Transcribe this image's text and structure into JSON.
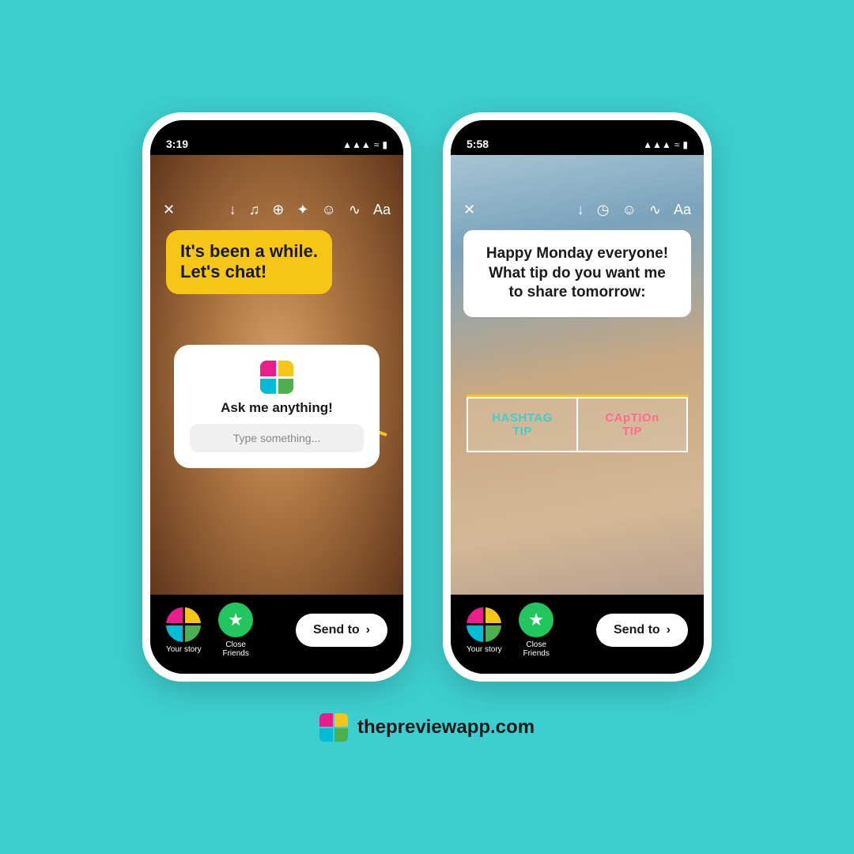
{
  "background_color": "#3DCFCF",
  "branding": {
    "website": "thepreviewapp.com"
  },
  "phone1": {
    "time": "3:19",
    "story_text_line1": "It's been a while.",
    "story_text_line2": "Let's chat!",
    "qa_title": "Ask me anything!",
    "qa_placeholder": "Type something...",
    "bottom": {
      "your_story_label": "Your story",
      "close_friends_label": "Close Friends",
      "send_to_label": "Send to"
    }
  },
  "phone2": {
    "time": "5:58",
    "caption_line1": "Happy Monday everyone!",
    "caption_line2": "What tip do you want me",
    "caption_line3": "to share tomorrow:",
    "poll_option1_line1": "HASHTAG",
    "poll_option1_line2": "TIP",
    "poll_option2_line1": "CApTIOn",
    "poll_option2_line2": "TIP",
    "bottom": {
      "your_story_label": "Your story",
      "close_friends_label": "Close Friends",
      "send_to_label": "Send to"
    }
  },
  "icons": {
    "close": "✕",
    "download": "↓",
    "music": "♫",
    "link": "🔗",
    "sparkle": "✦",
    "sticker": "☺",
    "draw": "✏",
    "text": "Aa",
    "arrow_right": "›",
    "star": "★",
    "signal": "▲▲▲",
    "wifi": "📶",
    "battery": "🔋"
  }
}
